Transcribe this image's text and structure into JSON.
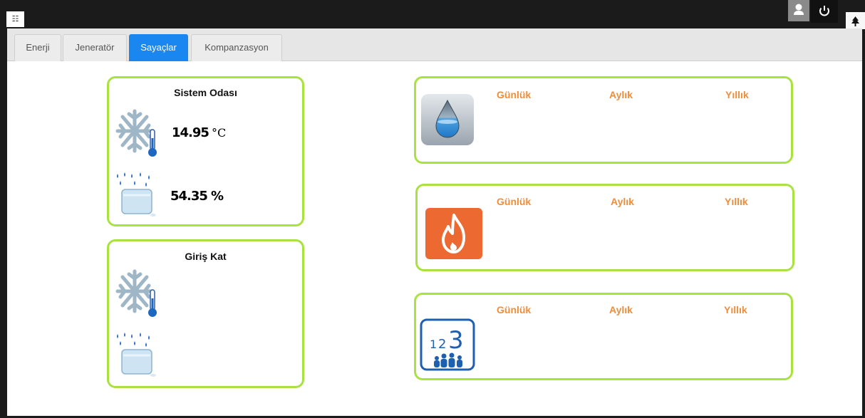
{
  "top_bar": {
    "apps_icon": "grid-icon",
    "user_icon": "user-icon",
    "power_icon": "power-icon",
    "tree_icon": "tree-icon"
  },
  "tabs": [
    {
      "label": "Enerji",
      "active": false
    },
    {
      "label": "Jeneratör",
      "active": false
    },
    {
      "label": "Sayaçlar",
      "active": true
    },
    {
      "label": "Kompanzasyon",
      "active": false
    }
  ],
  "rooms": [
    {
      "title": "Sistem Odası",
      "temperature": "14.95",
      "temperature_unit": "°C",
      "humidity": "54.35",
      "humidity_unit": "%"
    },
    {
      "title": "Giriş Kat",
      "temperature": "",
      "temperature_unit": "",
      "humidity": "",
      "humidity_unit": ""
    }
  ],
  "meters": [
    {
      "icon": "water-drop-icon",
      "daily": "Günlük",
      "monthly": "Aylık",
      "yearly": "Yıllık"
    },
    {
      "icon": "flame-icon",
      "daily": "Günlük",
      "monthly": "Aylık",
      "yearly": "Yıllık"
    },
    {
      "icon": "counter-123-icon",
      "daily": "Günlük",
      "monthly": "Aylık",
      "yearly": "Yıllık"
    }
  ],
  "colors": {
    "accent_tab": "#1a86f0",
    "card_border": "#a9e23f",
    "period_label": "#f08d3a"
  }
}
